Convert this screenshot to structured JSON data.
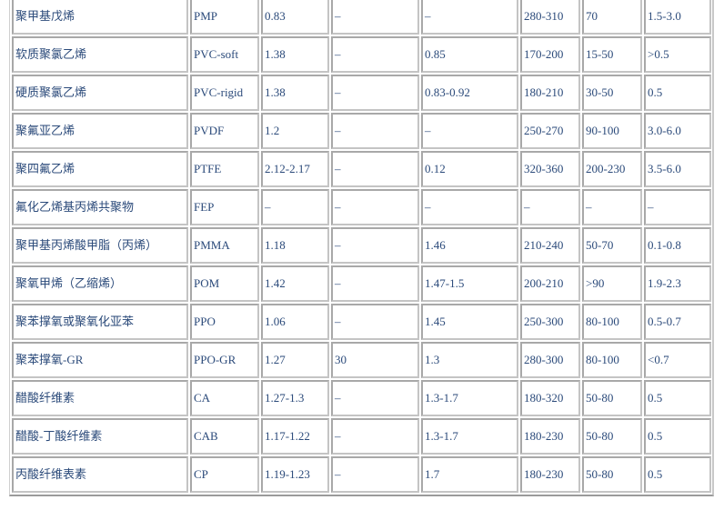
{
  "table": {
    "rows": [
      [
        "聚甲基戊烯",
        "PMP",
        "0.83",
        "–",
        "–",
        "280-310",
        "70",
        "1.5-3.0"
      ],
      [
        "软质聚氯乙烯",
        "PVC-soft",
        "1.38",
        "–",
        "0.85",
        "170-200",
        "15-50",
        ">0.5"
      ],
      [
        "硬质聚氯乙烯",
        "PVC-rigid",
        "1.38",
        "–",
        "0.83-0.92",
        "180-210",
        "30-50",
        "0.5"
      ],
      [
        "聚氟亚乙烯",
        "PVDF",
        "1.2",
        "–",
        "–",
        "250-270",
        "90-100",
        "3.0-6.0"
      ],
      [
        "聚四氟乙烯",
        "PTFE",
        "2.12-2.17",
        "–",
        "0.12",
        "320-360",
        "200-230",
        "3.5-6.0"
      ],
      [
        "氟化乙烯基丙烯共聚物",
        "FEP",
        "–",
        "–",
        "–",
        "–",
        "–",
        "–"
      ],
      [
        "聚甲基丙烯酸甲脂（丙烯）",
        "PMMA",
        "1.18",
        "–",
        "1.46",
        "210-240",
        "50-70",
        "0.1-0.8"
      ],
      [
        "聚氧甲烯（乙缩烯）",
        "POM",
        "1.42",
        "–",
        "1.47-1.5",
        "200-210",
        ">90",
        "1.9-2.3"
      ],
      [
        "聚苯撑氧或聚氧化亚苯",
        "PPO",
        "1.06",
        "–",
        "1.45",
        "250-300",
        "80-100",
        "0.5-0.7"
      ],
      [
        "聚苯撑氧-GR",
        "PPO-GR",
        "1.27",
        "30",
        "1.3",
        "280-300",
        "80-100",
        "<0.7"
      ],
      [
        "醋酸纤维素",
        "CA",
        "1.27-1.3",
        "–",
        "1.3-1.7",
        "180-320",
        "50-80",
        "0.5"
      ],
      [
        "醋酸-丁酸纤维素",
        "CAB",
        "1.17-1.22",
        "–",
        "1.3-1.7",
        "180-230",
        "50-80",
        "0.5"
      ],
      [
        "丙酸纤维表素",
        "CP",
        "1.19-1.23",
        "–",
        "1.7",
        "180-230",
        "50-80",
        "0.5"
      ]
    ]
  },
  "colors": {
    "text": "#2b4a7a",
    "border": "#a8a8a8"
  }
}
